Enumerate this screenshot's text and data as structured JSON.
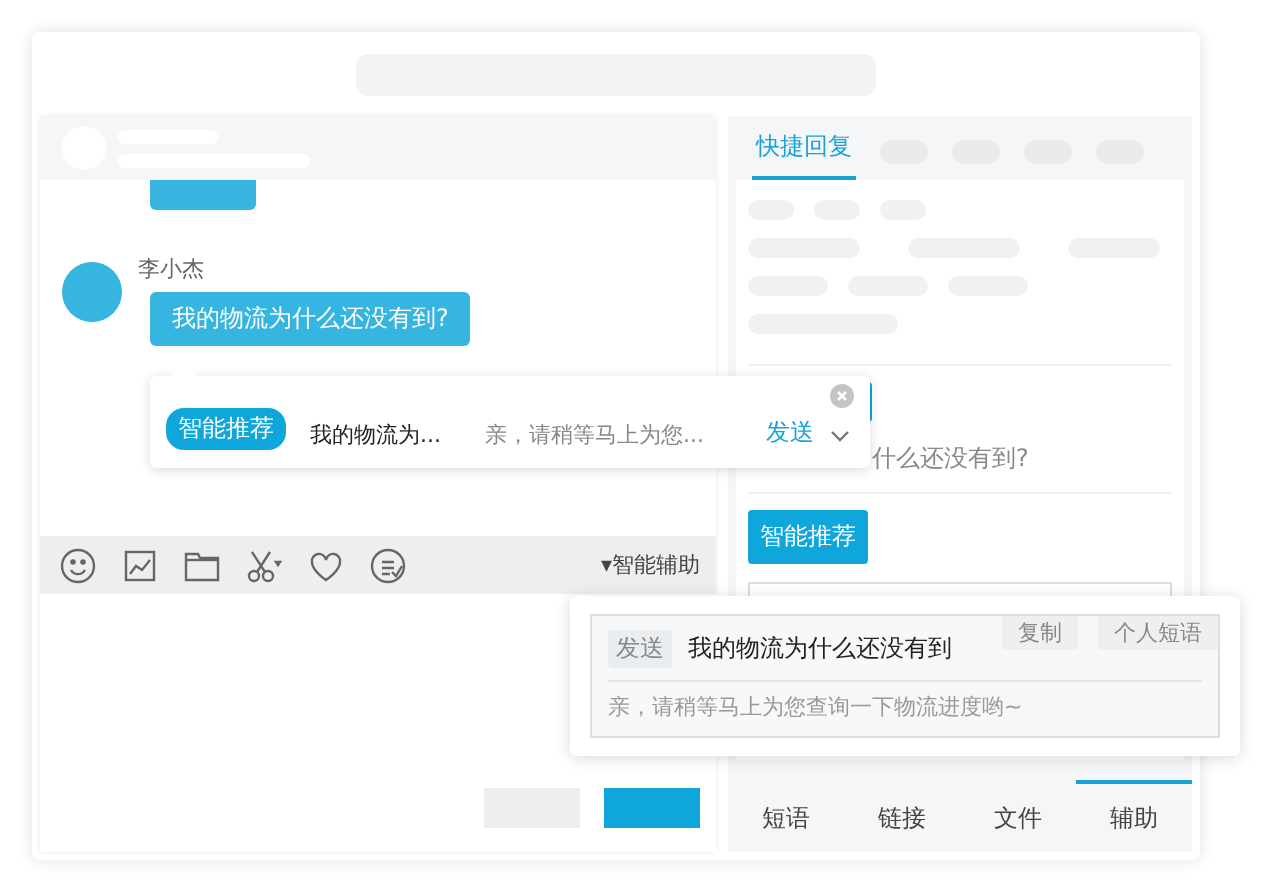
{
  "chat": {
    "messages": [
      {
        "sender": "李小杰",
        "text": "我的物流为什么还没有到?"
      }
    ]
  },
  "suggestion_popup": {
    "badge": "智能推荐",
    "question": "我的物流为...",
    "answer": "亲，请稍等马上为您...",
    "send": "发送"
  },
  "toolbar": {
    "assist_toggle": "▾智能辅助"
  },
  "side_panel": {
    "tabs": [
      {
        "label": "快捷回复",
        "selected": true
      }
    ],
    "question_fragment": "什么还没有到?",
    "smart_button": "智能推荐",
    "bottom_tabs": [
      {
        "label": "短语",
        "selected": false
      },
      {
        "label": "链接",
        "selected": false
      },
      {
        "label": "文件",
        "selected": false
      },
      {
        "label": "辅助",
        "selected": true
      }
    ]
  },
  "phrase_popup": {
    "send_tag": "发送",
    "question": "我的物流为什么还没有到",
    "actions": [
      "复制",
      "个人短语"
    ],
    "answer": "亲，请稍等马上为您查询一下物流进度哟~"
  }
}
